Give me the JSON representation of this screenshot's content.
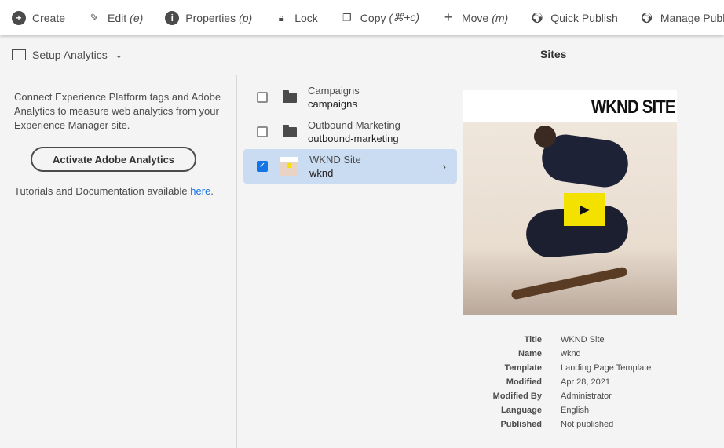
{
  "toolbar": {
    "create": "Create",
    "edit": "Edit",
    "edit_key": "(e)",
    "properties": "Properties",
    "properties_key": "(p)",
    "lock": "Lock",
    "copy": "Copy",
    "copy_key": "(⌘+c)",
    "move": "Move",
    "move_key": "(m)",
    "quick_publish": "Quick Publish",
    "manage_publication": "Manage Publication"
  },
  "subbar": {
    "rail_label": "Setup Analytics",
    "title": "Sites"
  },
  "rail": {
    "description": "Connect Experience Platform tags and Adobe Analytics to measure web analytics from your Experience Manager site.",
    "button": "Activate Adobe Analytics",
    "tutorial_text": "Tutorials and Documentation available ",
    "tutorial_link": "here",
    "tutorial_end": "."
  },
  "items": [
    {
      "title": "Campaigns",
      "name": "campaigns",
      "checked": false
    },
    {
      "title": "Outbound Marketing",
      "name": "outbound-marketing",
      "checked": false
    },
    {
      "title": "WKND Site",
      "name": "wknd",
      "checked": true
    }
  ],
  "preview": {
    "logo": "WKND SITE"
  },
  "meta": [
    {
      "k": "Title",
      "v": "WKND Site"
    },
    {
      "k": "Name",
      "v": "wknd"
    },
    {
      "k": "Template",
      "v": "Landing Page Template"
    },
    {
      "k": "Modified",
      "v": "Apr 28, 2021"
    },
    {
      "k": "Modified By",
      "v": "Administrator"
    },
    {
      "k": "Language",
      "v": "English"
    },
    {
      "k": "Published",
      "v": "Not published"
    }
  ],
  "colors": {
    "accent": "#1473e6",
    "selected_row": "#cadcf1",
    "play": "#f3e100"
  }
}
